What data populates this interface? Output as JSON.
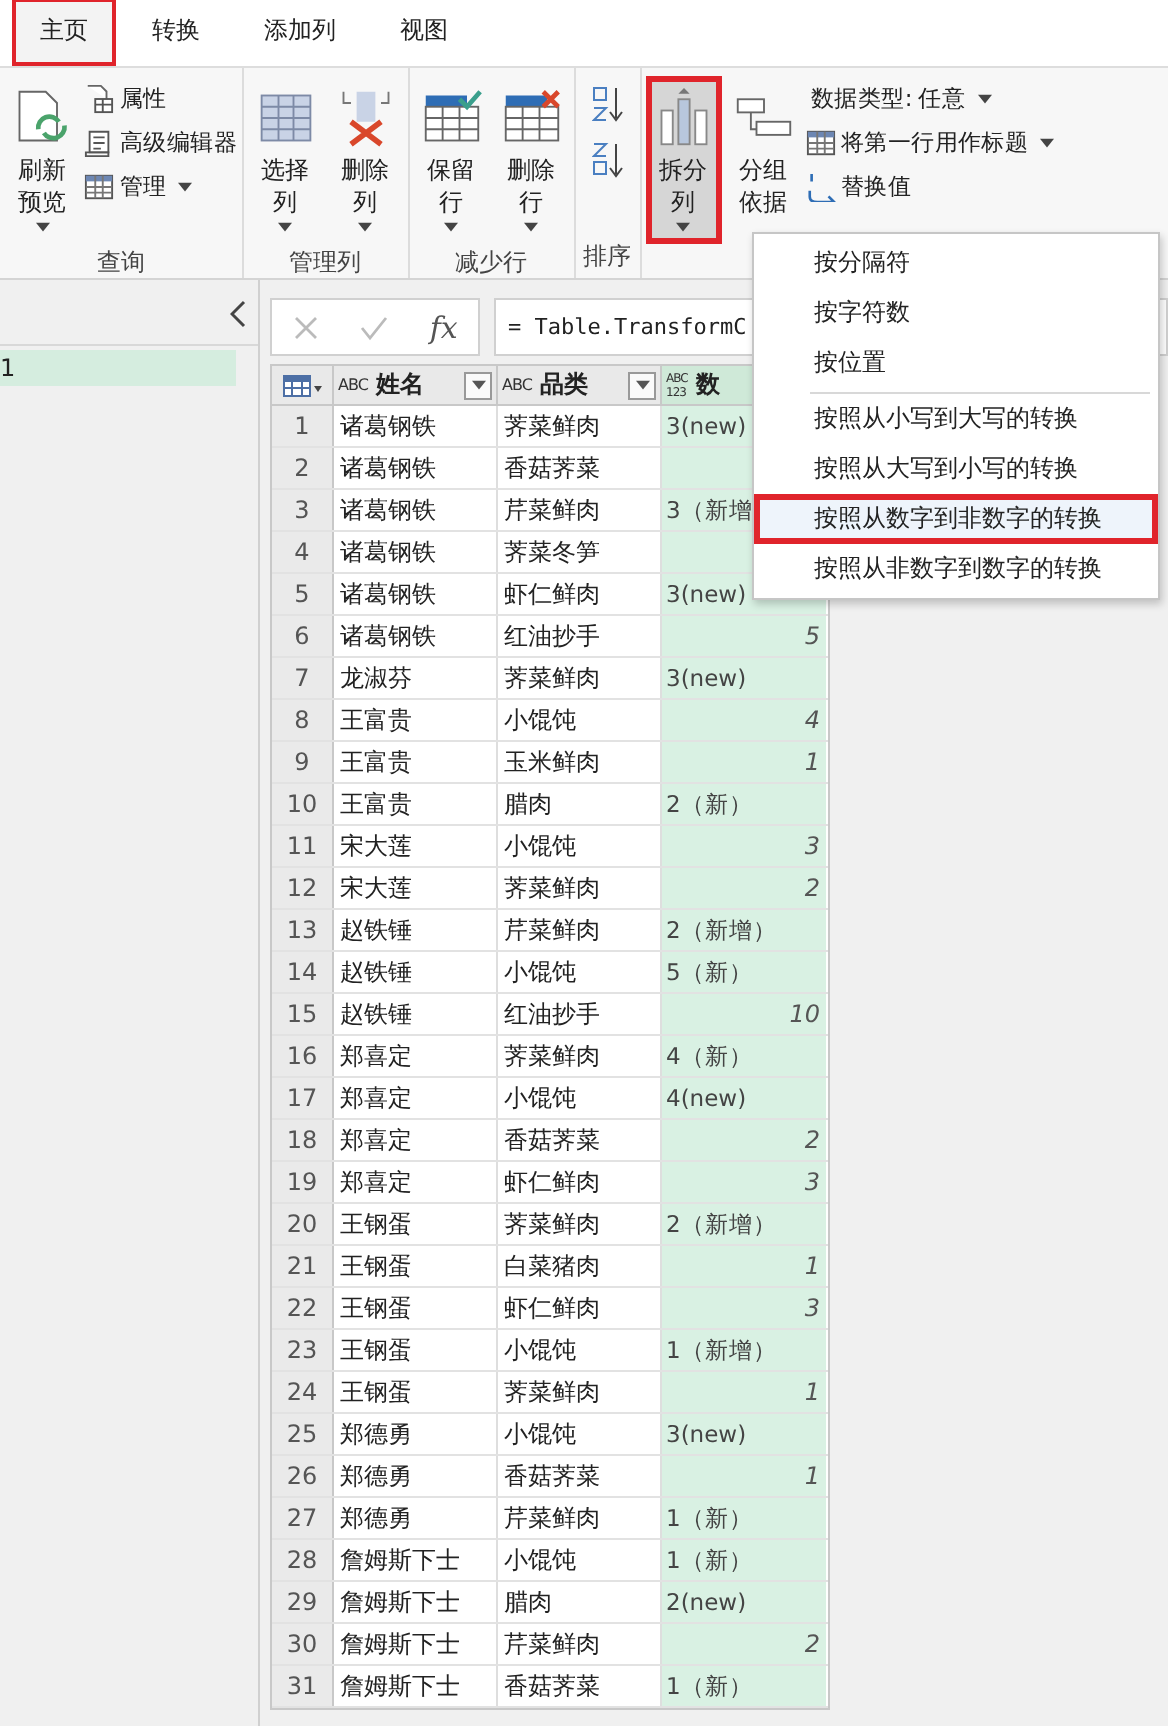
{
  "tabs": [
    {
      "label": "主页",
      "selected": true,
      "highlighted": true
    },
    {
      "label": "转换",
      "selected": false,
      "highlighted": false
    },
    {
      "label": "添加列",
      "selected": false,
      "highlighted": false
    },
    {
      "label": "视图",
      "selected": false,
      "highlighted": false
    }
  ],
  "ribbon": {
    "groups": [
      {
        "label": "查询",
        "buttons": [
          {
            "kind": "large",
            "lines": [
              "刷新",
              "预览"
            ],
            "dropdown": true,
            "highlighted": false
          },
          {
            "kind": "small",
            "label": "属性",
            "dropdown": false
          },
          {
            "kind": "small",
            "label": "高级编辑器",
            "dropdown": false
          },
          {
            "kind": "small",
            "label": "管理",
            "dropdown": true
          }
        ]
      },
      {
        "label": "管理列",
        "buttons": [
          {
            "kind": "large",
            "lines": [
              "选择",
              "列"
            ],
            "dropdown": true,
            "highlighted": false
          },
          {
            "kind": "large",
            "lines": [
              "删除",
              "列"
            ],
            "dropdown": true,
            "highlighted": false
          }
        ]
      },
      {
        "label": "减少行",
        "buttons": [
          {
            "kind": "large",
            "lines": [
              "保留",
              "行"
            ],
            "dropdown": true,
            "highlighted": false
          },
          {
            "kind": "large",
            "lines": [
              "删除",
              "行"
            ],
            "dropdown": true,
            "highlighted": false
          }
        ]
      },
      {
        "label": "排序",
        "buttons": [
          {
            "kind": "icon"
          },
          {
            "kind": "icon"
          }
        ]
      },
      {
        "buttons": [
          {
            "kind": "large",
            "lines": [
              "拆分",
              "列"
            ],
            "dropdown": true,
            "highlighted": true
          },
          {
            "kind": "large",
            "lines": [
              "分组",
              "依据"
            ],
            "dropdown": false,
            "highlighted": false
          },
          {
            "kind": "small",
            "label": "数据类型: 任意",
            "dropdown": true
          },
          {
            "kind": "small",
            "label": "将第一行用作标题",
            "dropdown": true
          },
          {
            "kind": "small",
            "label": "替换值",
            "dropdown": false
          }
        ]
      }
    ]
  },
  "queries": [
    {
      "label": "1",
      "selected": true
    }
  ],
  "formula_bar": {
    "fx": "fx",
    "formula": "= Table.TransformC"
  },
  "table": {
    "columns": [
      {
        "name": "姓名",
        "type_label": [
          "ABC"
        ],
        "filter": true
      },
      {
        "name": "品类",
        "type_label": [
          "ABC"
        ],
        "filter": true
      },
      {
        "name": "数",
        "type_label": [
          "ABC",
          "123"
        ],
        "filter": false
      }
    ],
    "rows": [
      {
        "n": "1",
        "name": "诸葛钢铁",
        "item": "荠菜鲜肉",
        "qty": {
          "kind": "text",
          "value": "3(new)"
        }
      },
      {
        "n": "2",
        "name": "诸葛钢铁",
        "item": "香菇荠菜"
      },
      {
        "n": "3",
        "name": "诸葛钢铁",
        "item": "芹菜鲜肉",
        "qty": {
          "kind": "text",
          "value": "3（新增"
        }
      },
      {
        "n": "4",
        "name": "诸葛钢铁",
        "item": "荠菜冬笋"
      },
      {
        "n": "5",
        "name": "诸葛钢铁",
        "item": "虾仁鲜肉",
        "qty": {
          "kind": "text",
          "value": "3(new)"
        }
      },
      {
        "n": "6",
        "name": "诸葛钢铁",
        "item": "红油抄手",
        "qty": {
          "kind": "number",
          "value": "5"
        }
      },
      {
        "n": "7",
        "name": "龙淑芬",
        "item": "荠菜鲜肉",
        "qty": {
          "kind": "text",
          "value": "3(new)"
        }
      },
      {
        "n": "8",
        "name": "王富贵",
        "item": "小馄饨",
        "qty": {
          "kind": "number",
          "value": "4"
        }
      },
      {
        "n": "9",
        "name": "王富贵",
        "item": "玉米鲜肉",
        "qty": {
          "kind": "number",
          "value": "1"
        }
      },
      {
        "n": "10",
        "name": "王富贵",
        "item": "腊肉",
        "qty": {
          "kind": "text",
          "value": "2（新）"
        }
      },
      {
        "n": "11",
        "name": "宋大莲",
        "item": "小馄饨",
        "qty": {
          "kind": "number",
          "value": "3"
        }
      },
      {
        "n": "12",
        "name": "宋大莲",
        "item": "荠菜鲜肉",
        "qty": {
          "kind": "number",
          "value": "2"
        }
      },
      {
        "n": "13",
        "name": "赵铁锤",
        "item": "芹菜鲜肉",
        "qty": {
          "kind": "text",
          "value": "2（新增）"
        }
      },
      {
        "n": "14",
        "name": "赵铁锤",
        "item": "小馄饨",
        "qty": {
          "kind": "text",
          "value": "5（新）"
        }
      },
      {
        "n": "15",
        "name": "赵铁锤",
        "item": "红油抄手",
        "qty": {
          "kind": "number",
          "value": "10"
        }
      },
      {
        "n": "16",
        "name": "郑喜定",
        "item": "荠菜鲜肉",
        "qty": {
          "kind": "text",
          "value": "4（新）"
        }
      },
      {
        "n": "17",
        "name": "郑喜定",
        "item": "小馄饨",
        "qty": {
          "kind": "text",
          "value": "4(new)"
        }
      },
      {
        "n": "18",
        "name": "郑喜定",
        "item": "香菇荠菜",
        "qty": {
          "kind": "number",
          "value": "2"
        }
      },
      {
        "n": "19",
        "name": "郑喜定",
        "item": "虾仁鲜肉",
        "qty": {
          "kind": "number",
          "value": "3"
        }
      },
      {
        "n": "20",
        "name": "王钢蛋",
        "item": "荠菜鲜肉",
        "qty": {
          "kind": "text",
          "value": "2（新增）"
        }
      },
      {
        "n": "21",
        "name": "王钢蛋",
        "item": "白菜猪肉",
        "qty": {
          "kind": "number",
          "value": "1"
        }
      },
      {
        "n": "22",
        "name": "王钢蛋",
        "item": "虾仁鲜肉",
        "qty": {
          "kind": "number",
          "value": "3"
        }
      },
      {
        "n": "23",
        "name": "王钢蛋",
        "item": "小馄饨",
        "qty": {
          "kind": "text",
          "value": "1（新增）"
        }
      },
      {
        "n": "24",
        "name": "王钢蛋",
        "item": "荠菜鲜肉",
        "qty": {
          "kind": "number",
          "value": "1"
        }
      },
      {
        "n": "25",
        "name": "郑德勇",
        "item": "小馄饨",
        "qty": {
          "kind": "text",
          "value": "3(new)"
        }
      },
      {
        "n": "26",
        "name": "郑德勇",
        "item": "香菇荠菜",
        "qty": {
          "kind": "number",
          "value": "1"
        }
      },
      {
        "n": "27",
        "name": "郑德勇",
        "item": "芹菜鲜肉",
        "qty": {
          "kind": "text",
          "value": "1（新）"
        }
      },
      {
        "n": "28",
        "name": "詹姆斯下士",
        "item": "小馄饨",
        "qty": {
          "kind": "text",
          "value": "1（新）"
        }
      },
      {
        "n": "29",
        "name": "詹姆斯下士",
        "item": "腊肉",
        "qty": {
          "kind": "text",
          "value": "2(new)"
        }
      },
      {
        "n": "30",
        "name": "詹姆斯下士",
        "item": "芹菜鲜肉",
        "qty": {
          "kind": "number",
          "value": "2"
        }
      },
      {
        "n": "31",
        "name": "詹姆斯下士",
        "item": "香菇荠菜",
        "qty": {
          "kind": "text",
          "value": "1（新）"
        }
      }
    ]
  },
  "menu": {
    "items": [
      {
        "label": "按分隔符",
        "divider_before": false,
        "highlighted": false
      },
      {
        "label": "按字符数",
        "divider_before": false,
        "highlighted": false
      },
      {
        "label": "按位置",
        "divider_before": false,
        "highlighted": false
      },
      {
        "label": "按照从小写到大写的转换",
        "divider_before": true,
        "highlighted": false
      },
      {
        "label": "按照从大写到小写的转换",
        "divider_before": false,
        "highlighted": false
      },
      {
        "label": "按照从数字到非数字的转换",
        "divider_before": false,
        "highlighted": true
      },
      {
        "label": "按照从非数字到数字的转换",
        "divider_before": false,
        "highlighted": false
      }
    ]
  }
}
